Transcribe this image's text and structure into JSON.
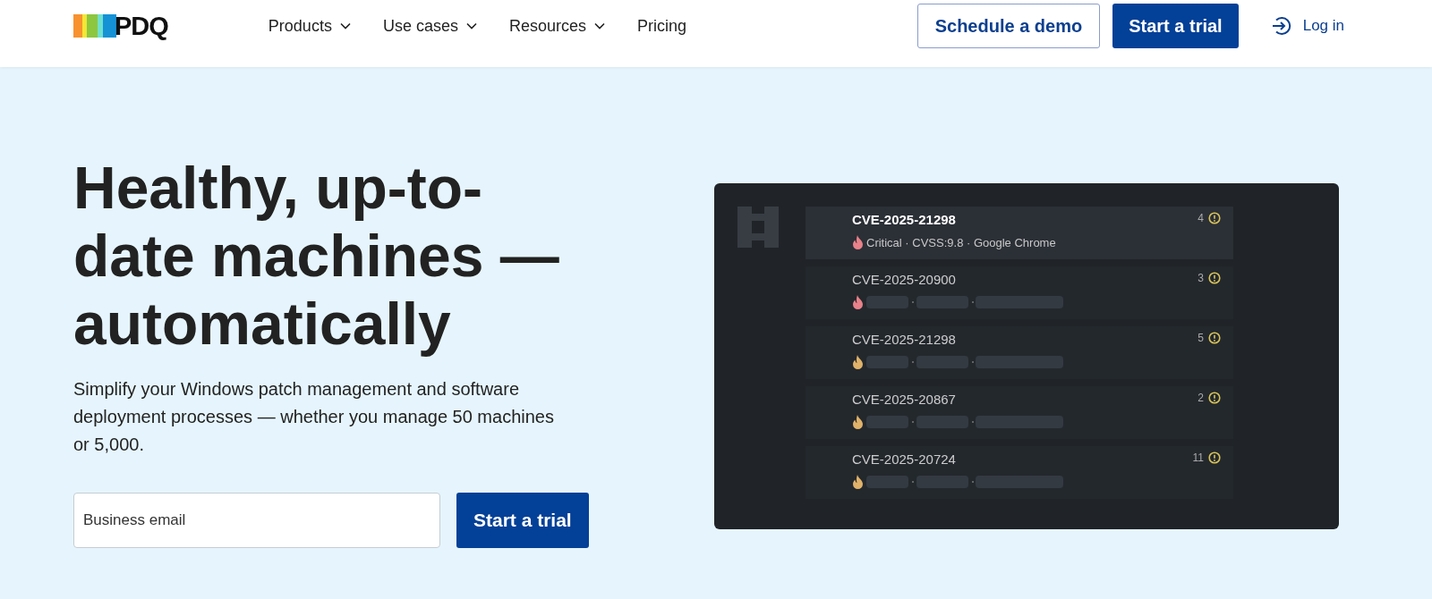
{
  "nav": {
    "logo": "PDQ",
    "items": [
      {
        "label": "Products",
        "dropdown": true
      },
      {
        "label": "Use cases",
        "dropdown": true
      },
      {
        "label": "Resources",
        "dropdown": true
      },
      {
        "label": "Pricing",
        "dropdown": false
      }
    ],
    "demo_button": "Schedule a demo",
    "trial_button": "Start a trial",
    "login": "Log in"
  },
  "hero": {
    "heading": "Healthy, up-to-date machines — automatically",
    "text": "Simplify your Windows patch management and software deployment processes — whether you manage 50 machines or 5,000.",
    "email": {
      "placeholder": "Business email"
    },
    "button": "Start a trial"
  },
  "panel": {
    "rows": [
      {
        "id": "CVE-2025-21298",
        "count": "4",
        "selected": true,
        "kind": "detail",
        "detail": "Critical · CVSS:9.8 · Google Chrome",
        "color": "#e8818a"
      },
      {
        "id": "CVE-2025-20900",
        "count": "3",
        "selected": false,
        "kind": "redacted",
        "color": "#e8818a"
      },
      {
        "id": "CVE-2025-21298",
        "count": "5",
        "selected": false,
        "kind": "redacted",
        "color": "#e0b26a"
      },
      {
        "id": "CVE-2025-20867",
        "count": "2",
        "selected": false,
        "kind": "redacted",
        "color": "#e0b26a"
      },
      {
        "id": "CVE-2025-20724",
        "count": "11",
        "selected": false,
        "kind": "redacted",
        "color": "#e0b26a"
      }
    ]
  }
}
